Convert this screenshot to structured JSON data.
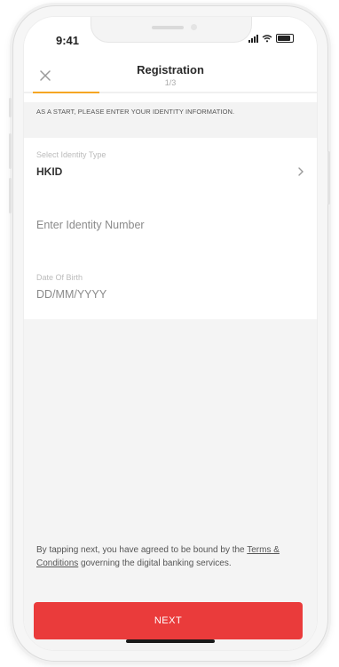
{
  "status_bar": {
    "time": "9:41"
  },
  "nav": {
    "title": "Registration",
    "step": "1/3",
    "progress": 0.33,
    "close_icon": "close-icon"
  },
  "intro": {
    "text": "AS A START, PLEASE ENTER YOUR IDENTITY INFORMATION."
  },
  "form": {
    "identity_type": {
      "label": "Select Identity Type",
      "value": "HKID",
      "icon": "chevron-right-icon"
    },
    "identity_number": {
      "placeholder": "Enter Identity Number"
    },
    "dob": {
      "label": "Date Of Birth",
      "placeholder": "DD/MM/YYYY"
    }
  },
  "terms": {
    "prefix": "By tapping next, you have agreed to be bound by the",
    "link": "Terms & Conditions",
    "suffix": "governing the digital banking services."
  },
  "next_label": "NEXT",
  "colors": {
    "accent": "#f5a623",
    "primary_button": "#ea3b3b"
  }
}
